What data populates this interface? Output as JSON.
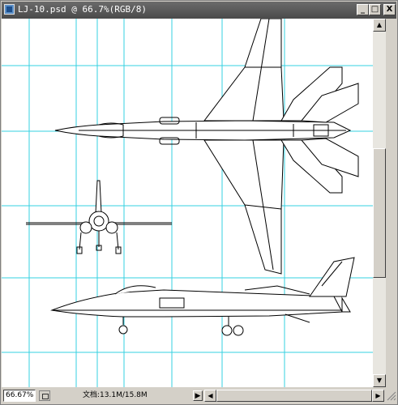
{
  "window": {
    "title": "LJ-10.psd @ 66.7%(RGB/8)",
    "controls": {
      "minimize": "_",
      "maximize": "□",
      "close": "X"
    }
  },
  "status": {
    "zoom": "66.67%",
    "doc_info": "文档:13.1M/15.8M",
    "arrow": "▶"
  },
  "colors": {
    "guide": "#35d0e0",
    "drawing": "#000000",
    "titlebar": "#555555"
  }
}
